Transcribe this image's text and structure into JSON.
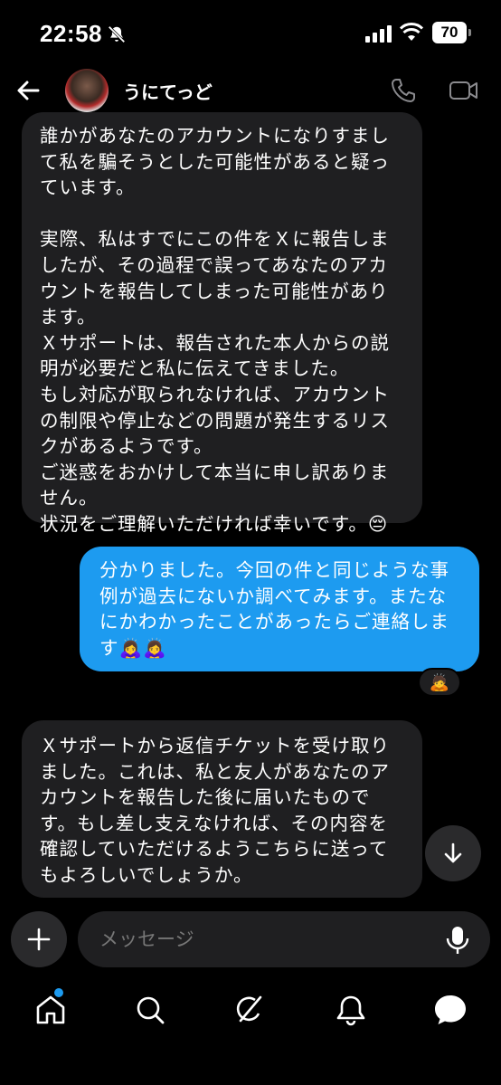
{
  "status_bar": {
    "time": "22:58",
    "battery": "70",
    "icons": [
      "bell-off-icon",
      "signal-icon",
      "wifi-icon",
      "battery-icon"
    ]
  },
  "header": {
    "name": "うにてっど",
    "icons": [
      "back-arrow-icon",
      "phone-icon",
      "video-icon"
    ]
  },
  "messages": [
    {
      "direction": "incoming",
      "text": "誰かがあなたのアカウントになりすまして私を騙そうとした可能性があると疑っています。\n\n実際、私はすでにこの件をＸに報告しましたが、その過程で誤ってあなたのアカウントを報告してしまった可能性があります。\nＸサポートは、報告された本人からの説明が必要だと私に伝えてきました。\nもし対応が取られなければ、アカウントの制限や停止などの問題が発生するリスクがあるようです。\nご迷惑をおかけして本当に申し訳ありません。\n状況をご理解いただければ幸いです。😔"
    },
    {
      "direction": "outgoing",
      "text": "分かりました。今回の件と同じような事例が過去にないか調べてみます。またなにかわかったことがあったらご連絡します🙇‍♀️🙇‍♀️",
      "reaction": "🙇"
    },
    {
      "direction": "incoming",
      "text": "Ｘサポートから返信チケットを受け取りました。これは、私と友人があなたのアカウントを報告した後に届いたものです。もし差し支えなければ、その内容を確認していただけるようこちらに送ってもよろしいでしょうか。"
    }
  ],
  "composer": {
    "placeholder": "メッセージ",
    "icons": [
      "plus-icon",
      "mic-icon"
    ]
  },
  "bottom_nav": {
    "items": [
      "home-icon",
      "search-icon",
      "grok-icon",
      "bell-icon",
      "messages-icon"
    ],
    "active": "messages-icon",
    "accent": "#1d9bf0"
  },
  "colors": {
    "background": "#000000",
    "incoming_bubble": "#1f1f21",
    "outgoing_bubble": "#1d9bf0"
  }
}
